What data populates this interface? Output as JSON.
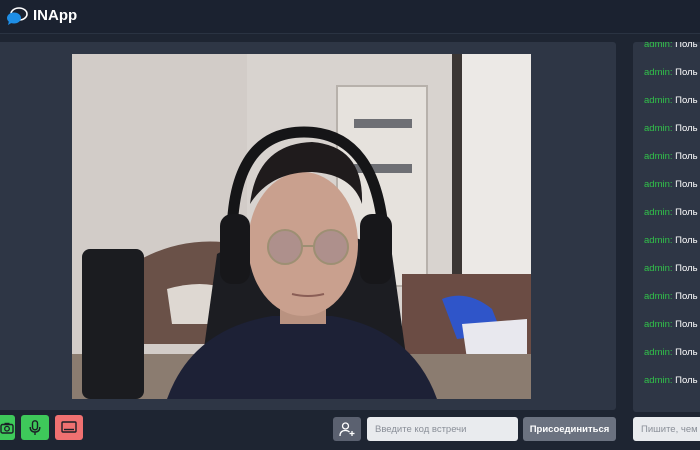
{
  "app": {
    "title": "INApp"
  },
  "meeting": {
    "code_placeholder": "Введите код встречи",
    "join_label": "Присоединиться"
  },
  "chat": {
    "input_placeholder": "Пишите, чем х",
    "messages": [
      {
        "user": "admin:",
        "text": "Поль"
      },
      {
        "user": "admin:",
        "text": "Поль"
      },
      {
        "user": "admin:",
        "text": "Поль"
      },
      {
        "user": "admin:",
        "text": "Поль"
      },
      {
        "user": "admin:",
        "text": "Поль"
      },
      {
        "user": "admin:",
        "text": "Поль"
      },
      {
        "user": "admin:",
        "text": "Поль"
      },
      {
        "user": "admin:",
        "text": "Поль"
      },
      {
        "user": "admin:",
        "text": "Поль"
      },
      {
        "user": "admin:",
        "text": "Поль"
      },
      {
        "user": "admin:",
        "text": "Поль"
      },
      {
        "user": "admin:",
        "text": "Поль"
      },
      {
        "user": "admin:",
        "text": "Поль"
      }
    ]
  },
  "controls": [
    {
      "name": "camera-toggle-button",
      "icon": "camera-icon",
      "color": "#3ec95a"
    },
    {
      "name": "mic-toggle-button",
      "icon": "microphone-icon",
      "color": "#3ec95a"
    },
    {
      "name": "screen-share-button",
      "icon": "screen-icon",
      "color": "#f07171"
    }
  ],
  "colors": {
    "accent_green": "#31c24a",
    "panel": "#2e3645",
    "background": "#1e2532"
  }
}
